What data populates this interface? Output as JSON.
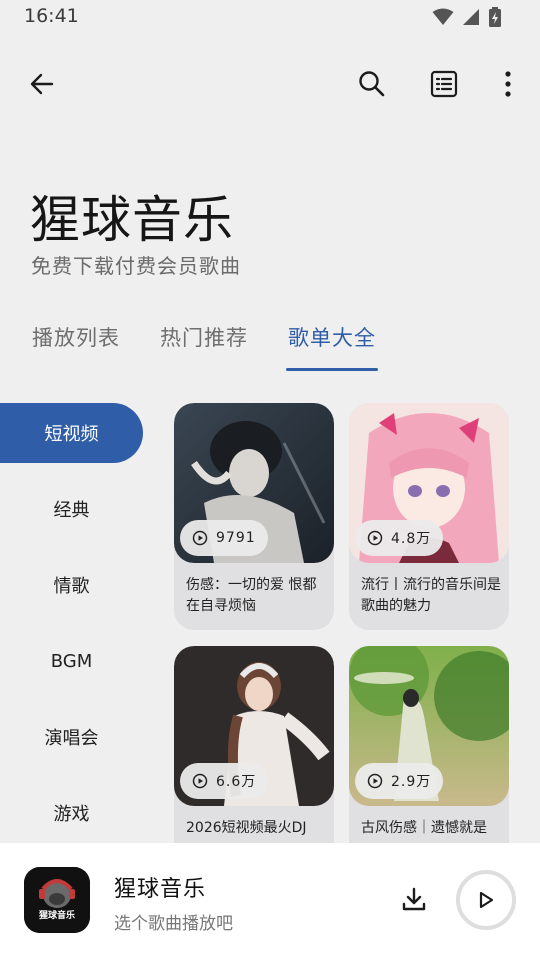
{
  "status_bar": {
    "time": "16:41",
    "icons": [
      "wifi-icon",
      "signal-icon",
      "battery-charging-icon"
    ]
  },
  "toolbar": {
    "back_icon": "arrow-left-icon",
    "search_icon": "search-icon",
    "list_icon": "list-icon",
    "more_icon": "more-vertical-icon"
  },
  "header": {
    "title": "猩球音乐",
    "subtitle": "免费下载付费会员歌曲"
  },
  "tabs": [
    {
      "label": "播放列表",
      "active": false
    },
    {
      "label": "热门推荐",
      "active": false
    },
    {
      "label": "歌单大全",
      "active": true
    }
  ],
  "categories": [
    {
      "label": "短视频",
      "active": true
    },
    {
      "label": "经典",
      "active": false
    },
    {
      "label": "情歌",
      "active": false
    },
    {
      "label": "BGM",
      "active": false
    },
    {
      "label": "演唱会",
      "active": false
    },
    {
      "label": "游戏",
      "active": false
    }
  ],
  "playlists": [
    {
      "plays": "9791",
      "title": "伤感：一切的爱 恨都在自寻烦恼"
    },
    {
      "plays": "4.8万",
      "title": "流行丨流行的音乐间是歌曲的魅力"
    },
    {
      "plays": "6.6万",
      "title": "2026短视频最火DJ"
    },
    {
      "plays": "2.9万",
      "title": "古风伤感｜遗憾就是"
    }
  ],
  "player": {
    "title": "猩球音乐",
    "subtitle": "选个歌曲播放吧",
    "cover_text": "猩球音乐",
    "download_icon": "download-icon",
    "play_icon": "play-icon"
  },
  "colors": {
    "accent": "#2f5da8",
    "background": "#efefef",
    "card": "#e0e0e2"
  }
}
